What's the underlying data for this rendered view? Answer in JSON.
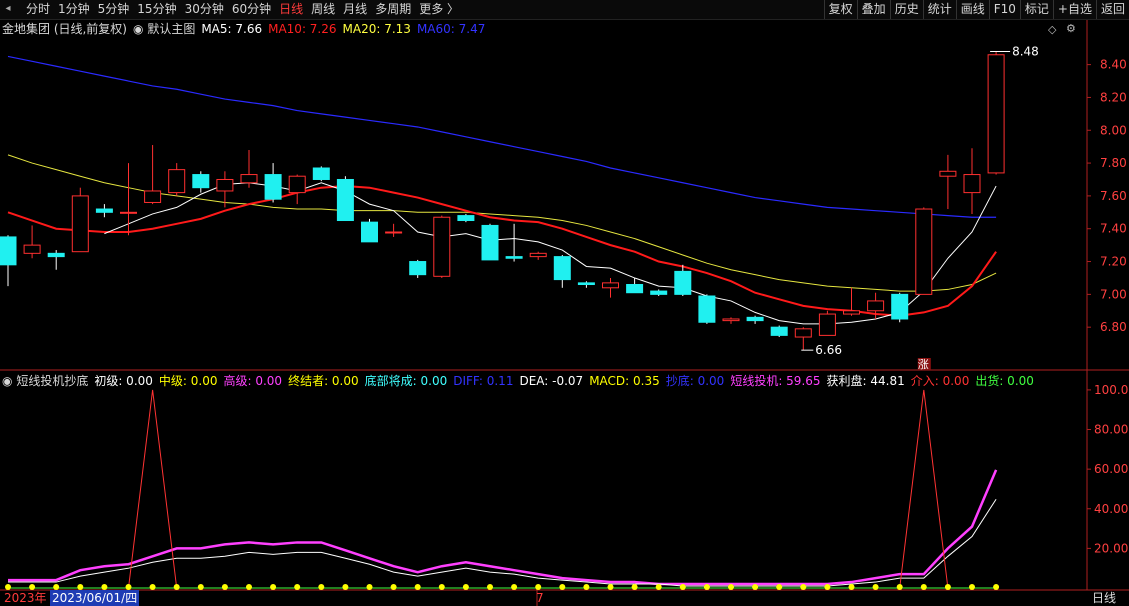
{
  "topbar": {
    "tabs": [
      {
        "label": "分时",
        "active": false
      },
      {
        "label": "1分钟",
        "active": false
      },
      {
        "label": "5分钟",
        "active": false
      },
      {
        "label": "15分钟",
        "active": false
      },
      {
        "label": "30分钟",
        "active": false
      },
      {
        "label": "60分钟",
        "active": false
      },
      {
        "label": "日线",
        "active": true
      },
      {
        "label": "周线",
        "active": false
      },
      {
        "label": "月线",
        "active": false
      },
      {
        "label": "多周期",
        "active": false
      },
      {
        "label": "更多 〉",
        "active": false
      }
    ],
    "tools": [
      "复权",
      "叠加",
      "历史",
      "统计",
      "画线",
      "F10",
      "标记",
      "+自选",
      "返回"
    ]
  },
  "main": {
    "stock": "金地集团 (日线,前复权)",
    "template": "默认主图",
    "ma": [
      {
        "label": "MA5: 7.66",
        "color": "#ffffff"
      },
      {
        "label": "MA10: 7.26",
        "color": "#ff2020"
      },
      {
        "label": "MA20: 7.13",
        "color": "#ffff40"
      },
      {
        "label": "MA60: 7.47",
        "color": "#3333ff"
      }
    ],
    "y_ticks": [
      "8.40",
      "8.20",
      "8.00",
      "7.80",
      "7.60",
      "7.40",
      "7.20",
      "7.00",
      "6.80"
    ],
    "high_label": "8.48",
    "low_label": "6.66",
    "mark_label": "涨"
  },
  "indicator": {
    "name": "短线投机抄底",
    "items": [
      {
        "label": "初级: 0.00",
        "color": "#ffffff"
      },
      {
        "label": "中级: 0.00",
        "color": "#ffff00"
      },
      {
        "label": "高级: 0.00",
        "color": "#ff40ff"
      },
      {
        "label": "终结者: 0.00",
        "color": "#ffff00"
      },
      {
        "label": "底部将成: 0.00",
        "color": "#40ffff"
      },
      {
        "label": "DIFF: 0.11",
        "color": "#3333ff"
      },
      {
        "label": "DEA: -0.07",
        "color": "#ffffff"
      },
      {
        "label": "MACD: 0.35",
        "color": "#ffff00"
      },
      {
        "label": "抄底: 0.00",
        "color": "#3333ff"
      },
      {
        "label": "短线投机: 59.65",
        "color": "#ff40ff"
      },
      {
        "label": "获利盘: 44.81",
        "color": "#ffffff"
      },
      {
        "label": "介入: 0.00",
        "color": "#ff3333"
      },
      {
        "label": "出货: 0.00",
        "color": "#40ff40"
      }
    ],
    "y_ticks": [
      "100.0",
      "80.00",
      "60.00",
      "40.00",
      "20.00"
    ]
  },
  "xaxis": {
    "year": "2023年",
    "date": "2023/06/01/四",
    "month": "7",
    "period": "日线"
  },
  "chart_data": [
    {
      "type": "candlestick",
      "ylim": [
        6.6,
        8.55
      ],
      "candles": [
        {
          "o": 7.35,
          "h": 7.36,
          "l": 7.05,
          "c": 7.18
        },
        {
          "o": 7.25,
          "h": 7.42,
          "l": 7.22,
          "c": 7.3
        },
        {
          "o": 7.25,
          "h": 7.27,
          "l": 7.15,
          "c": 7.23
        },
        {
          "o": 7.26,
          "h": 7.65,
          "l": 7.26,
          "c": 7.6
        },
        {
          "o": 7.52,
          "h": 7.55,
          "l": 7.47,
          "c": 7.5
        },
        {
          "o": 7.5,
          "h": 7.8,
          "l": 7.36,
          "c": 7.5
        },
        {
          "o": 7.56,
          "h": 7.91,
          "l": 7.55,
          "c": 7.63
        },
        {
          "o": 7.62,
          "h": 7.8,
          "l": 7.6,
          "c": 7.76
        },
        {
          "o": 7.73,
          "h": 7.75,
          "l": 7.62,
          "c": 7.65
        },
        {
          "o": 7.63,
          "h": 7.75,
          "l": 7.53,
          "c": 7.7
        },
        {
          "o": 7.68,
          "h": 7.88,
          "l": 7.65,
          "c": 7.73
        },
        {
          "o": 7.73,
          "h": 7.8,
          "l": 7.56,
          "c": 7.58
        },
        {
          "o": 7.62,
          "h": 7.73,
          "l": 7.55,
          "c": 7.72
        },
        {
          "o": 7.77,
          "h": 7.78,
          "l": 7.69,
          "c": 7.7
        },
        {
          "o": 7.7,
          "h": 7.72,
          "l": 7.45,
          "c": 7.45
        },
        {
          "o": 7.44,
          "h": 7.46,
          "l": 7.33,
          "c": 7.32
        },
        {
          "o": 7.38,
          "h": 7.43,
          "l": 7.35,
          "c": 7.38
        },
        {
          "o": 7.2,
          "h": 7.21,
          "l": 7.1,
          "c": 7.12
        },
        {
          "o": 7.11,
          "h": 7.48,
          "l": 7.1,
          "c": 7.47
        },
        {
          "o": 7.48,
          "h": 7.49,
          "l": 7.44,
          "c": 7.45
        },
        {
          "o": 7.42,
          "h": 7.43,
          "l": 7.22,
          "c": 7.21
        },
        {
          "o": 7.23,
          "h": 7.43,
          "l": 7.2,
          "c": 7.22
        },
        {
          "o": 7.23,
          "h": 7.26,
          "l": 7.21,
          "c": 7.25
        },
        {
          "o": 7.23,
          "h": 7.24,
          "l": 7.04,
          "c": 7.09
        },
        {
          "o": 7.07,
          "h": 7.08,
          "l": 7.04,
          "c": 7.06
        },
        {
          "o": 7.04,
          "h": 7.1,
          "l": 6.98,
          "c": 7.07
        },
        {
          "o": 7.06,
          "h": 7.1,
          "l": 7.01,
          "c": 7.01
        },
        {
          "o": 7.02,
          "h": 7.03,
          "l": 6.99,
          "c": 7.0
        },
        {
          "o": 7.14,
          "h": 7.18,
          "l": 6.99,
          "c": 7.0
        },
        {
          "o": 6.99,
          "h": 7.0,
          "l": 6.82,
          "c": 6.83
        },
        {
          "o": 6.84,
          "h": 6.86,
          "l": 6.82,
          "c": 6.85
        },
        {
          "o": 6.86,
          "h": 6.87,
          "l": 6.82,
          "c": 6.84
        },
        {
          "o": 6.8,
          "h": 6.81,
          "l": 6.74,
          "c": 6.75
        },
        {
          "o": 6.74,
          "h": 6.8,
          "l": 6.66,
          "c": 6.79
        },
        {
          "o": 6.75,
          "h": 6.9,
          "l": 6.75,
          "c": 6.88
        },
        {
          "o": 6.88,
          "h": 7.04,
          "l": 6.87,
          "c": 6.9
        },
        {
          "o": 6.9,
          "h": 7.01,
          "l": 6.85,
          "c": 6.96
        },
        {
          "o": 7.0,
          "h": 7.01,
          "l": 6.83,
          "c": 6.85
        },
        {
          "o": 7.0,
          "h": 7.53,
          "l": 7.0,
          "c": 7.52
        },
        {
          "o": 7.72,
          "h": 7.85,
          "l": 7.52,
          "c": 7.75
        },
        {
          "o": 7.62,
          "h": 7.89,
          "l": 7.49,
          "c": 7.73
        },
        {
          "o": 7.74,
          "h": 8.48,
          "l": 7.73,
          "c": 8.46
        }
      ],
      "ma5": [
        null,
        null,
        null,
        null,
        7.37,
        7.43,
        7.49,
        7.53,
        7.61,
        7.67,
        7.68,
        7.66,
        7.63,
        7.68,
        7.63,
        7.55,
        7.51,
        7.38,
        7.35,
        7.37,
        7.33,
        7.34,
        7.32,
        7.27,
        7.17,
        7.16,
        7.1,
        7.05,
        7.04,
        6.99,
        6.96,
        6.89,
        6.84,
        6.82,
        6.82,
        6.83,
        6.85,
        6.89,
        7.02,
        7.22,
        7.38,
        7.66
      ],
      "ma10": [
        7.5,
        7.45,
        7.4,
        7.39,
        7.38,
        7.38,
        7.4,
        7.43,
        7.46,
        7.51,
        7.55,
        7.58,
        7.62,
        7.65,
        7.66,
        7.65,
        7.62,
        7.59,
        7.55,
        7.51,
        7.47,
        7.45,
        7.44,
        7.4,
        7.35,
        7.3,
        7.26,
        7.2,
        7.17,
        7.13,
        7.08,
        7.01,
        6.97,
        6.93,
        6.91,
        6.9,
        6.88,
        6.87,
        6.89,
        6.93,
        7.05,
        7.26
      ],
      "ma20": [
        7.85,
        7.8,
        7.76,
        7.72,
        7.68,
        7.65,
        7.62,
        7.6,
        7.58,
        7.56,
        7.55,
        7.53,
        7.52,
        7.52,
        7.51,
        7.51,
        7.51,
        7.5,
        7.5,
        7.5,
        7.49,
        7.48,
        7.47,
        7.45,
        7.42,
        7.38,
        7.34,
        7.29,
        7.24,
        7.19,
        7.15,
        7.12,
        7.09,
        7.07,
        7.05,
        7.04,
        7.03,
        7.02,
        7.02,
        7.03,
        7.06,
        7.13
      ],
      "ma60": [
        8.45,
        8.42,
        8.39,
        8.36,
        8.33,
        8.3,
        8.27,
        8.25,
        8.22,
        8.19,
        8.17,
        8.15,
        8.12,
        8.1,
        8.08,
        8.06,
        8.04,
        8.02,
        7.99,
        7.96,
        7.93,
        7.9,
        7.87,
        7.84,
        7.81,
        7.77,
        7.74,
        7.71,
        7.68,
        7.65,
        7.62,
        7.59,
        7.57,
        7.55,
        7.53,
        7.52,
        7.51,
        7.5,
        7.49,
        7.48,
        7.47,
        7.47
      ]
    },
    {
      "type": "line",
      "ylim": [
        0,
        105
      ],
      "series": [
        {
          "name": "短线投机",
          "color": "#ff40ff",
          "values": [
            4,
            4,
            4,
            9,
            11,
            12,
            16,
            20,
            20,
            22,
            23,
            22,
            23,
            23,
            19,
            15,
            11,
            8,
            11,
            13,
            11,
            9,
            7,
            5,
            4,
            3,
            3,
            2,
            2,
            2,
            2,
            2,
            2,
            2,
            2,
            3,
            5,
            7,
            7,
            20,
            31,
            59.65
          ]
        },
        {
          "name": "获利盘",
          "color": "#ffffff",
          "values": [
            3,
            3,
            3,
            6,
            8,
            10,
            13,
            15,
            15,
            16,
            18,
            17,
            18,
            18,
            15,
            12,
            8,
            6,
            8,
            10,
            8,
            7,
            5,
            4,
            3,
            2,
            2,
            2,
            1,
            1,
            1,
            1,
            1,
            1,
            1,
            2,
            3,
            5,
            5,
            16,
            26,
            44.81
          ]
        },
        {
          "name": "介入",
          "color": "#ff3333",
          "values": [
            0,
            0,
            0,
            0,
            0,
            0,
            100,
            0,
            0,
            0,
            0,
            0,
            0,
            0,
            0,
            0,
            0,
            0,
            0,
            0,
            0,
            0,
            0,
            0,
            0,
            0,
            0,
            0,
            0,
            0,
            0,
            0,
            0,
            0,
            0,
            0,
            0,
            0,
            100,
            0,
            0,
            0
          ]
        },
        {
          "name": "出货",
          "color": "#40ff40",
          "values": [
            0,
            0,
            0,
            0,
            0,
            0,
            0,
            0,
            0,
            0,
            0,
            0,
            0,
            0,
            0,
            0,
            0,
            0,
            0,
            0,
            0,
            0,
            0,
            0,
            0,
            0,
            0,
            0,
            0,
            0,
            0,
            0,
            0,
            0,
            0,
            0,
            0,
            0,
            0,
            0,
            0,
            0
          ]
        }
      ]
    }
  ]
}
